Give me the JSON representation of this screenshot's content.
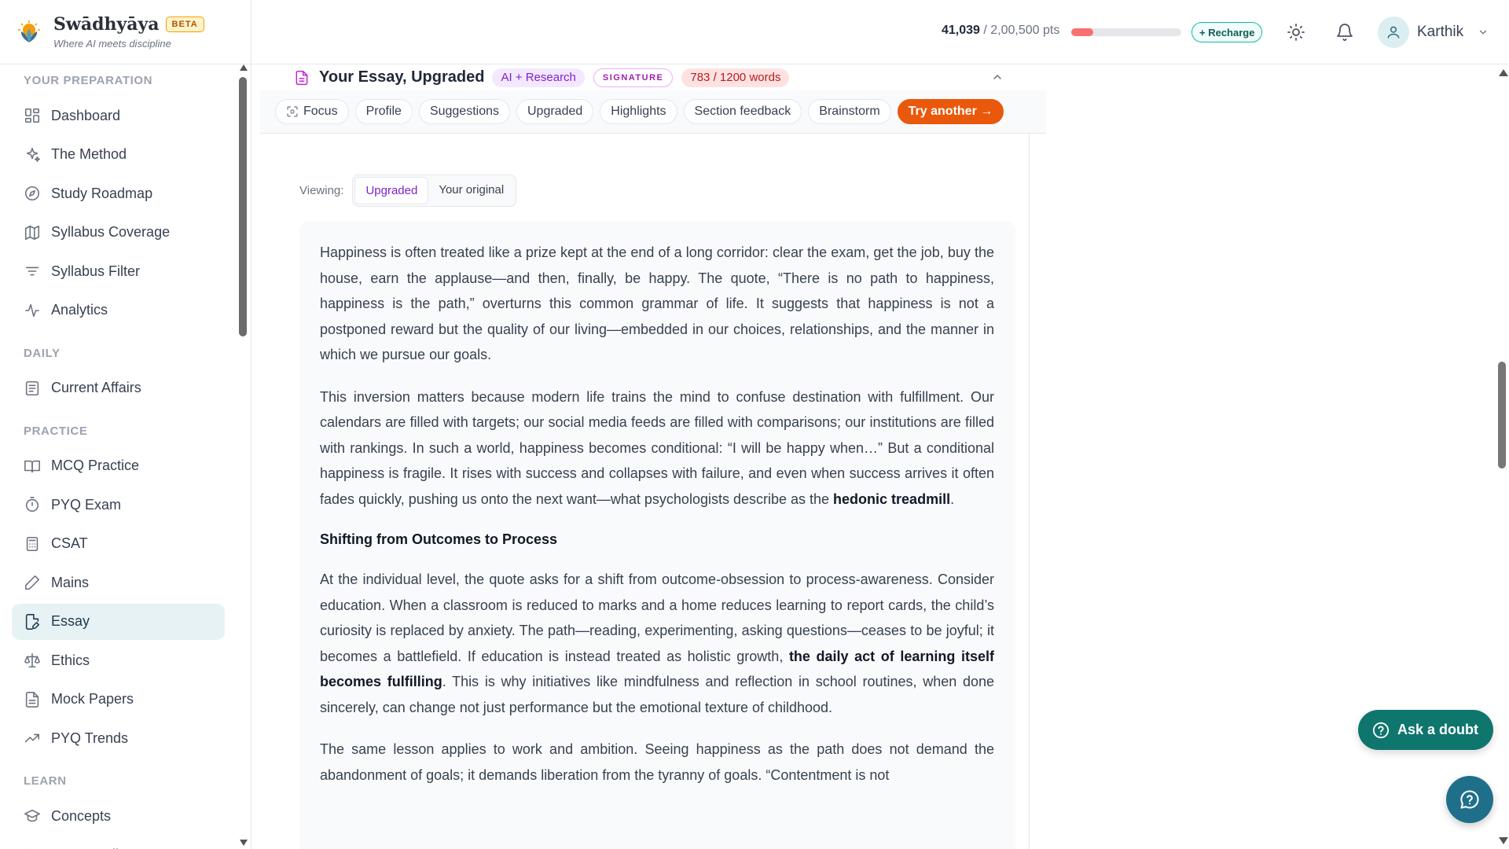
{
  "brand": {
    "name": "Swādhyāya",
    "badge": "BETA",
    "tagline": "Where AI meets discipline"
  },
  "sidebar": {
    "sections": [
      {
        "title": "YOUR PREPARATION",
        "items": [
          {
            "label": "Dashboard",
            "icon": "dashboard-icon"
          },
          {
            "label": "The Method",
            "icon": "sparkle-icon"
          },
          {
            "label": "Study Roadmap",
            "icon": "compass-icon"
          },
          {
            "label": "Syllabus Coverage",
            "icon": "map-icon"
          },
          {
            "label": "Syllabus Filter",
            "icon": "filter-icon"
          },
          {
            "label": "Analytics",
            "icon": "activity-icon"
          }
        ]
      },
      {
        "title": "DAILY",
        "items": [
          {
            "label": "Current Affairs",
            "icon": "newspaper-icon"
          }
        ]
      },
      {
        "title": "PRACTICE",
        "items": [
          {
            "label": "MCQ Practice",
            "icon": "book-icon"
          },
          {
            "label": "PYQ Exam",
            "icon": "timer-icon"
          },
          {
            "label": "CSAT",
            "icon": "calculator-icon"
          },
          {
            "label": "Mains",
            "icon": "pen-icon"
          },
          {
            "label": "Essay",
            "icon": "essay-icon",
            "active": true
          },
          {
            "label": "Ethics",
            "icon": "scale-icon"
          },
          {
            "label": "Mock Papers",
            "icon": "document-icon"
          },
          {
            "label": "PYQ Trends",
            "icon": "trending-up-icon"
          }
        ]
      },
      {
        "title": "LEARN",
        "items": [
          {
            "label": "Concepts",
            "icon": "graduation-cap-icon"
          },
          {
            "label": "Content Library",
            "icon": "library-icon"
          }
        ]
      }
    ]
  },
  "header": {
    "points_current": "41,039",
    "points_total": "/ 2,00,500 pts",
    "points_progress": 0.2,
    "recharge_label": "+ Recharge",
    "user_name": "Karthik"
  },
  "essay": {
    "title": "Your Essay, Upgraded",
    "chip_ai": "AI + Research",
    "chip_signature": "SIGNATURE",
    "chip_words": "783 / 1200 words",
    "tabs": [
      "Focus",
      "Profile",
      "Suggestions",
      "Upgraded",
      "Highlights",
      "Section feedback",
      "Brainstorm"
    ],
    "cta": "Try another →",
    "viewing_label": "Viewing:",
    "view_upgraded": "Upgraded",
    "view_original": "Your original",
    "p1": "Happiness is often treated like a prize kept at the end of a long corridor: clear the exam, get the job, buy the house, earn the applause—and then, finally, be happy. The quote, “There is no path to happiness, happiness is the path,” overturns this common grammar of life. It suggests that happiness is not a postponed reward but the quality of our living—embedded in our choices, relationships, and the manner in which we pursue our goals.",
    "p2_a": "This inversion matters because modern life trains the mind to confuse destination with fulfillment. Our calendars are filled with targets; our social media feeds are filled with comparisons; our institutions are filled with rankings. In such a world, happiness becomes conditional: “I will be happy when…” But a conditional happiness is fragile. It rises with success and collapses with failure, and even when success arrives it often fades quickly, pushing us onto the next want—what psychologists describe as the ",
    "p2_bold": "hedonic treadmill",
    "p2_end": ".",
    "h1": "Shifting from Outcomes to Process",
    "p3_a": "At the individual level, the quote asks for a shift from outcome-obsession to process-awareness. Consider education. When a classroom is reduced to marks and a home reduces learning to report cards, the child’s curiosity is replaced by anxiety. The path—reading, experimenting, asking questions—ceases to be joyful; it becomes a battlefield. If education is instead treated as holistic growth, ",
    "p3_bold": "the daily act of learning itself becomes fulfilling",
    "p3_b": ". This is why initiatives like mindfulness and reflection in school routines, when done sincerely, can change not just performance but the emotional texture of childhood.",
    "p4": "The same lesson applies to work and ambition. Seeing happiness as the path does not demand the abandonment of goals; it demands liberation from the tyranny of goals. “Contentment is not"
  },
  "floating": {
    "ask_doubt": "Ask a doubt"
  },
  "colors": {
    "accent": "#0f766e",
    "cta": "#ea580c",
    "active_nav": "#e7f2f5"
  }
}
